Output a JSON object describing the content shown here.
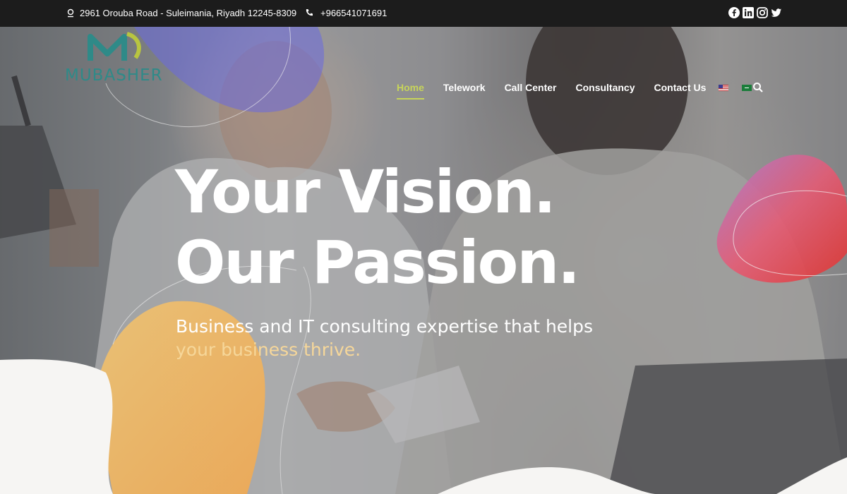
{
  "topbar": {
    "address": "2961 Orouba Road - Suleimania, Riyadh 12245-8309",
    "phone": "+966541071691",
    "address_icon": "location-pin-icon",
    "phone_icon": "phone-icon",
    "social": [
      "facebook-icon",
      "linkedin-icon",
      "instagram-icon",
      "twitter-icon"
    ]
  },
  "logo": {
    "word": "MUBASHER"
  },
  "nav": {
    "items": [
      {
        "label": "Home",
        "active": true
      },
      {
        "label": "Telework",
        "active": false
      },
      {
        "label": "Call Center",
        "active": false
      },
      {
        "label": "Consultancy",
        "active": false
      },
      {
        "label": "Contact Us",
        "active": false
      }
    ],
    "languages": [
      "english-flag-icon",
      "arabic-flag-icon"
    ],
    "search_icon": "search-icon"
  },
  "hero": {
    "headline_line1": "Your Vision.",
    "headline_line2": "Our Passion.",
    "sub_line1": "Business and IT consulting expertise that helps",
    "sub_line2": "your business thrive."
  },
  "colors": {
    "topbar_bg": "#1c1c1c",
    "nav_active": "#c7d45a",
    "accent_yellow": "#f6d79a",
    "logo_teal": "#2f8a88"
  }
}
